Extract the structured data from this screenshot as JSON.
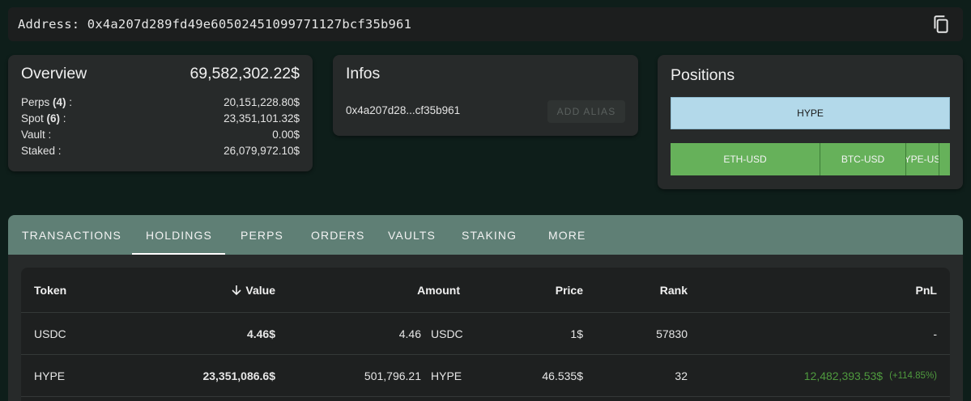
{
  "address": {
    "text": "Address: 0x4a207d289fd49e60502451099771127bcf35b961"
  },
  "overview": {
    "title": "Overview",
    "total": "69,582,302.22$",
    "rows": [
      {
        "label": "Perps",
        "count": "(4)",
        "suffix": " :",
        "value": "20,151,228.80$"
      },
      {
        "label": "Spot",
        "count": "(6)",
        "suffix": " :",
        "value": "23,351,101.32$"
      },
      {
        "label": "Vault :",
        "count": "",
        "suffix": "",
        "value": "0.00$"
      },
      {
        "label": "Staked :",
        "count": "",
        "suffix": "",
        "value": "26,079,972.10$"
      }
    ]
  },
  "infos": {
    "title": "Infos",
    "short_address": "0x4a207d28...cf35b961",
    "alias_button": "ADD ALIAS"
  },
  "positions": {
    "title": "Positions",
    "long": [
      {
        "name": "HYPE",
        "color": "#b3d9ea"
      }
    ],
    "short": [
      {
        "name": "ETH-USD",
        "color": "#66b15a"
      },
      {
        "name": "BTC-USD",
        "color": "#66b15a"
      },
      {
        "name": "HYPE-USD",
        "color": "#66b15a"
      },
      {
        "name": "",
        "color": "#66b15a"
      }
    ]
  },
  "tabs": [
    "TRANSACTIONS",
    "HOLDINGS",
    "PERPS",
    "ORDERS",
    "VAULTS",
    "STAKING",
    "MORE"
  ],
  "active_tab": "HOLDINGS",
  "table": {
    "headers": {
      "token": "Token",
      "value": "Value",
      "amount": "Amount",
      "price": "Price",
      "rank": "Rank",
      "pnl": "PnL"
    },
    "sort_icon": "arrow-down-icon",
    "rows": [
      {
        "token": "USDC",
        "value": "4.46$",
        "amount": "4.46",
        "amount_token": "USDC",
        "price": "1$",
        "rank": "57830",
        "pnl": "-",
        "pnl_pct": ""
      },
      {
        "token": "HYPE",
        "value": "23,351,086.6$",
        "amount": "501,796.21",
        "amount_token": "HYPE",
        "price": "46.535$",
        "rank": "32",
        "pnl": "12,482,393.53$",
        "pnl_pct": "(+114.85%)"
      }
    ]
  },
  "colors": {
    "accent": "#5f7f75",
    "profit": "#4f9a3e",
    "background": "#0e1e1a"
  }
}
